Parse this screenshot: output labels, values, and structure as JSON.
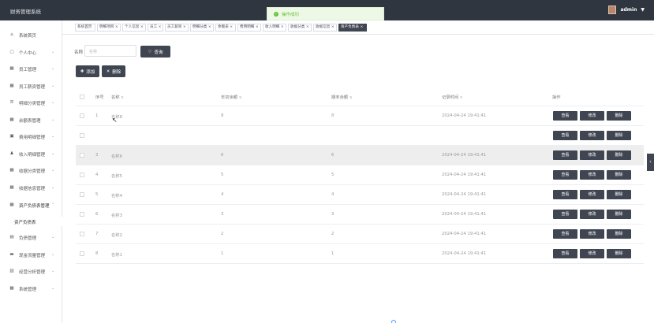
{
  "app": {
    "title": "财务管理系统",
    "username": "admin"
  },
  "toast": {
    "message": "操作成功"
  },
  "sidebar": {
    "items": [
      {
        "label": "系统首页",
        "icon": "home-icon",
        "glyph": "⌂",
        "arrow": false
      },
      {
        "label": "个人中心",
        "icon": "calendar-icon",
        "glyph": "▢",
        "arrow": true
      },
      {
        "label": "员工管理",
        "icon": "grid-icon",
        "glyph": "▦",
        "arrow": true
      },
      {
        "label": "员工薪资管理",
        "icon": "grid-icon",
        "glyph": "▦",
        "arrow": true
      },
      {
        "label": "明细分类管理",
        "icon": "list-icon",
        "glyph": "☰",
        "arrow": true
      },
      {
        "label": "余额表管理",
        "icon": "grid-icon",
        "glyph": "▦",
        "arrow": true
      },
      {
        "label": "费用明细管理",
        "icon": "chart-icon",
        "glyph": "▣",
        "arrow": true
      },
      {
        "label": "收入明细管理",
        "icon": "person-icon",
        "glyph": "♟",
        "arrow": true
      },
      {
        "label": "收据分类管理",
        "icon": "grid-icon",
        "glyph": "▦",
        "arrow": true
      },
      {
        "label": "收据信息管理",
        "icon": "grid-icon",
        "glyph": "▦",
        "arrow": true
      },
      {
        "label": "资产负债表管理",
        "icon": "grid-icon",
        "glyph": "▦",
        "arrow": true,
        "open": true
      },
      {
        "label": "负债管理",
        "icon": "book-icon",
        "glyph": "▤",
        "arrow": true
      },
      {
        "label": "现金流量管理",
        "icon": "wallet-icon",
        "glyph": "▬",
        "arrow": true
      },
      {
        "label": "经营分析管理",
        "icon": "bar-chart-icon",
        "glyph": "▥",
        "arrow": true
      },
      {
        "label": "系统管理",
        "icon": "grid-icon",
        "glyph": "▦",
        "arrow": true
      }
    ],
    "sub_item": "资产负债表"
  },
  "tabs": [
    {
      "label": "系统首页",
      "active": false
    },
    {
      "label": "明细项目",
      "active": false
    },
    {
      "label": "个人信息",
      "active": false
    },
    {
      "label": "员工",
      "active": false
    },
    {
      "label": "员工薪资",
      "active": false
    },
    {
      "label": "明细分类",
      "active": false
    },
    {
      "label": "余额表",
      "active": false
    },
    {
      "label": "费用明细",
      "active": false
    },
    {
      "label": "收入明细",
      "active": false
    },
    {
      "label": "收据分类",
      "active": false
    },
    {
      "label": "收据信息",
      "active": false
    },
    {
      "label": "资产负债表",
      "active": true
    }
  ],
  "search": {
    "label": "名称",
    "placeholder": "名称",
    "button": "查询"
  },
  "toolbar": {
    "add": "添加",
    "delete": "删除"
  },
  "table": {
    "headers": [
      "序号",
      "名称",
      "年初余额",
      "期末余额",
      "记录时间",
      "操作"
    ],
    "rows": [
      {
        "index": "1",
        "name": "名称8",
        "start": "8",
        "end": "8",
        "time": "2024-04-24 19:41:41"
      },
      {
        "index": "",
        "name": "",
        "start": "",
        "end": "",
        "time": ""
      },
      {
        "index": "3",
        "name": "名称6",
        "start": "6",
        "end": "6",
        "time": "2024-04-24 19:41:41"
      },
      {
        "index": "4",
        "name": "名称5",
        "start": "5",
        "end": "5",
        "time": "2024-04-24 19:41:41"
      },
      {
        "index": "5",
        "name": "名称4",
        "start": "4",
        "end": "4",
        "time": "2024-04-24 19:41:41"
      },
      {
        "index": "6",
        "name": "名称3",
        "start": "3",
        "end": "3",
        "time": "2024-04-24 19:41:41"
      },
      {
        "index": "7",
        "name": "名称2",
        "start": "2",
        "end": "2",
        "time": "2024-04-24 19:41:41"
      },
      {
        "index": "8",
        "name": "名称1",
        "start": "1",
        "end": "1",
        "time": "2024-04-24 19:41:41"
      }
    ],
    "actions": [
      "查看",
      "修改",
      "删除"
    ]
  },
  "colors": {
    "topbar": "#2f3640",
    "button": "#404552",
    "toast_text": "#67c23a"
  }
}
